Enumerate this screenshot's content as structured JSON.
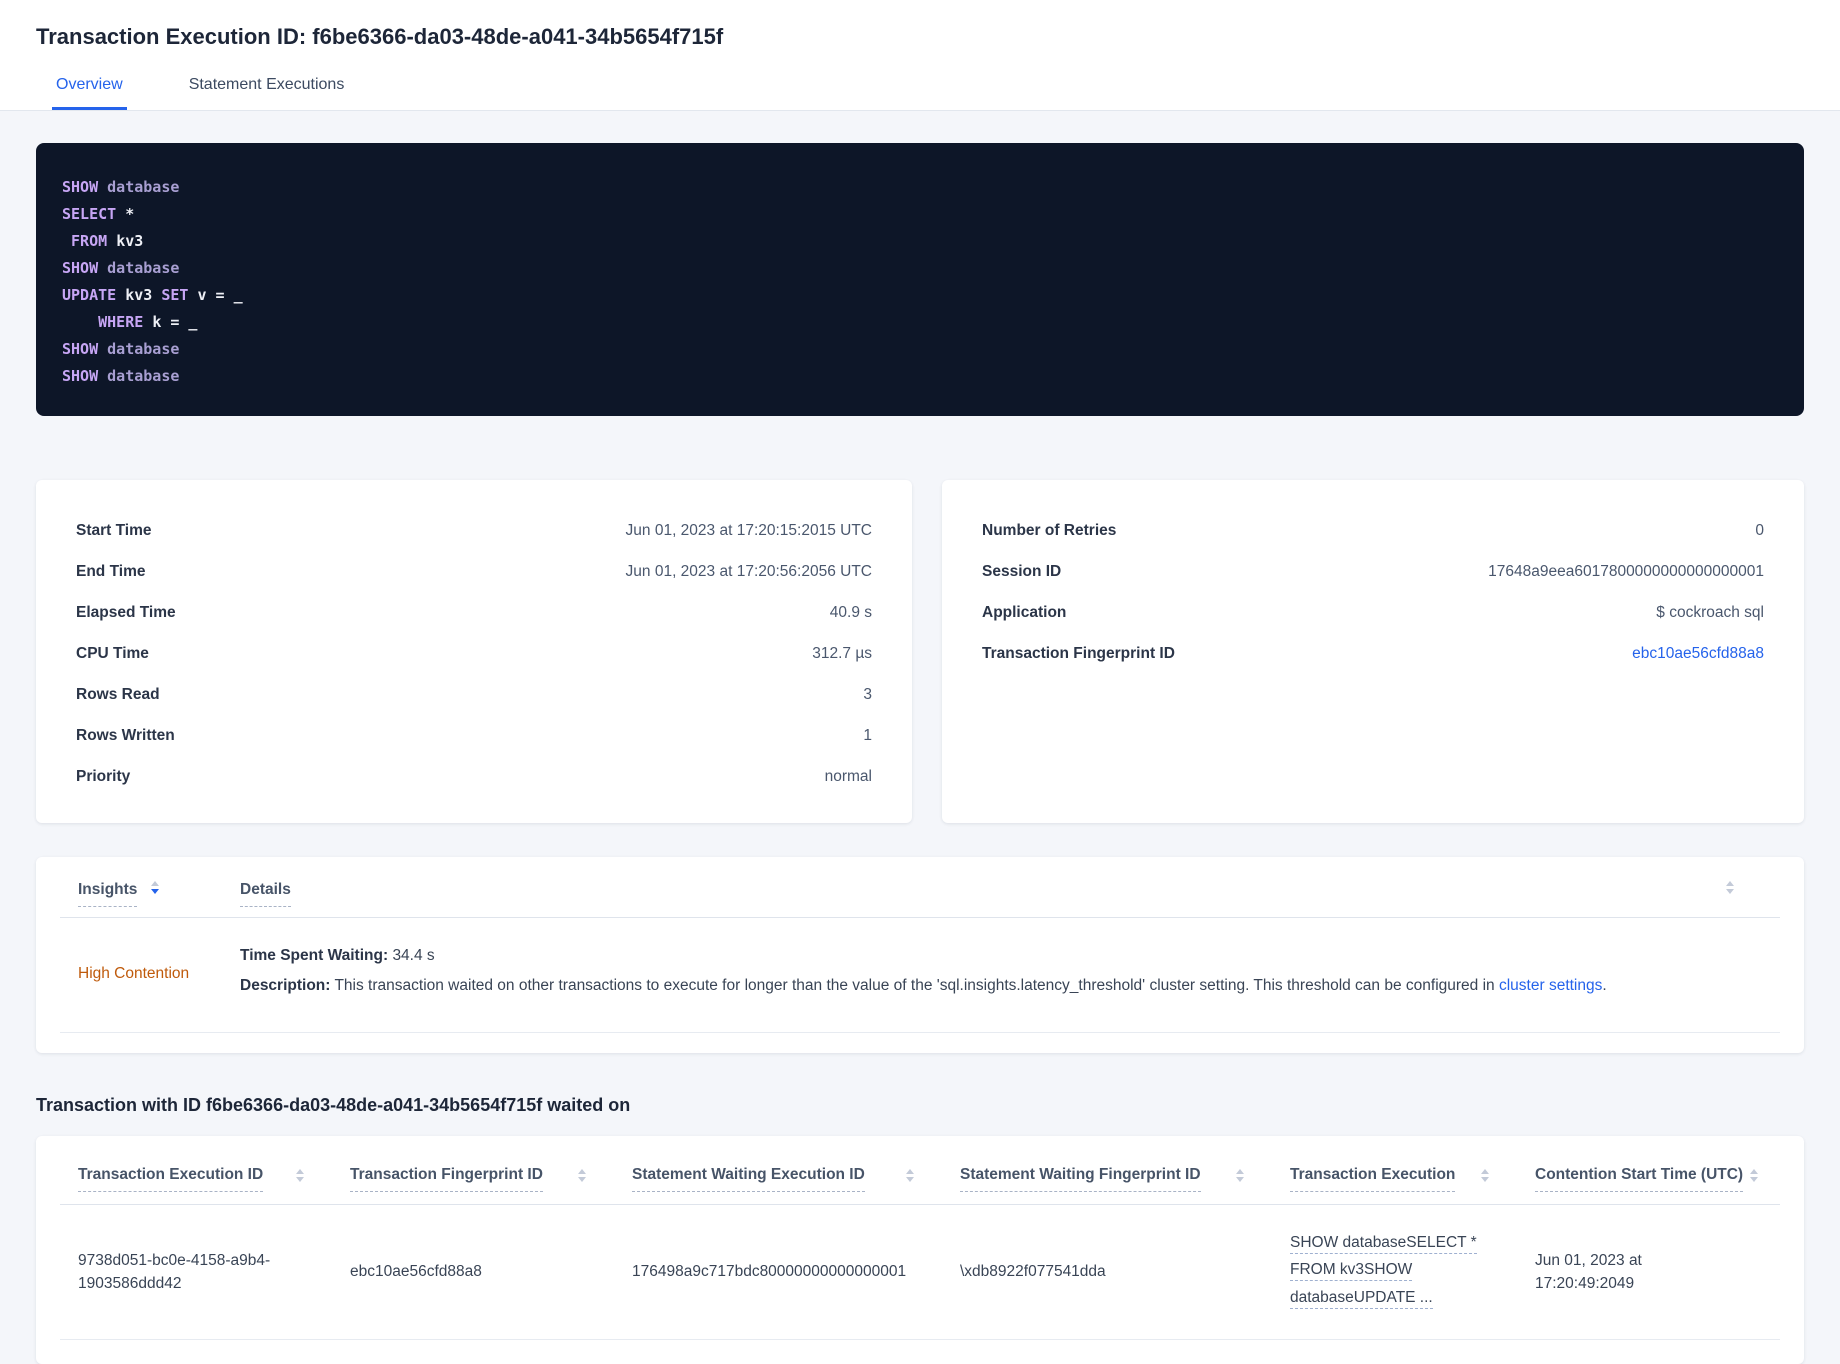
{
  "header": {
    "title": "Transaction Execution ID: f6be6366-da03-48de-a041-34b5654f715f",
    "tabs": [
      {
        "label": "Overview",
        "active": true
      },
      {
        "label": "Statement Executions",
        "active": false
      }
    ]
  },
  "sql": {
    "lines": [
      {
        "s": [
          {
            "t": "SHOW ",
            "k": "kw"
          },
          {
            "t": "database",
            "k": "db"
          }
        ]
      },
      {
        "s": [
          {
            "t": "SELECT ",
            "k": "kw"
          },
          {
            "t": "*",
            "k": "pl"
          }
        ]
      },
      {
        "s": [
          {
            "t": " ",
            "k": "pl"
          },
          {
            "t": "FROM ",
            "k": "kw"
          },
          {
            "t": "kv3",
            "k": "pl"
          }
        ]
      },
      {
        "s": [
          {
            "t": "SHOW ",
            "k": "kw"
          },
          {
            "t": "database",
            "k": "db"
          }
        ]
      },
      {
        "s": [
          {
            "t": "UPDATE ",
            "k": "kw"
          },
          {
            "t": "kv3 ",
            "k": "pl"
          },
          {
            "t": "SET ",
            "k": "kw"
          },
          {
            "t": "v = _",
            "k": "pl"
          }
        ]
      },
      {
        "s": [
          {
            "t": "    ",
            "k": "pl"
          },
          {
            "t": "WHERE ",
            "k": "kw"
          },
          {
            "t": "k = _",
            "k": "pl"
          }
        ]
      },
      {
        "s": [
          {
            "t": "SHOW ",
            "k": "kw"
          },
          {
            "t": "database",
            "k": "db"
          }
        ]
      },
      {
        "s": [
          {
            "t": "SHOW ",
            "k": "kw"
          },
          {
            "t": "database",
            "k": "db"
          }
        ]
      }
    ]
  },
  "summary_left": {
    "rows": [
      {
        "label": "Start Time",
        "value": "Jun 01, 2023 at 17:20:15:2015 UTC"
      },
      {
        "label": "End Time",
        "value": "Jun 01, 2023 at 17:20:56:2056 UTC"
      },
      {
        "label": "Elapsed Time",
        "value": "40.9 s"
      },
      {
        "label": "CPU Time",
        "value": "312.7 µs"
      },
      {
        "label": "Rows Read",
        "value": "3"
      },
      {
        "label": "Rows Written",
        "value": "1"
      },
      {
        "label": "Priority",
        "value": "normal"
      }
    ]
  },
  "summary_right": {
    "rows": [
      {
        "label": "Number of Retries",
        "value": "0"
      },
      {
        "label": "Session ID",
        "value": "17648a9eea6017800000000000000001"
      },
      {
        "label": "Application",
        "value": "$ cockroach sql"
      },
      {
        "label": "Transaction Fingerprint ID",
        "value": "ebc10ae56cfd88a8"
      }
    ]
  },
  "insights": {
    "col_insights": "Insights",
    "col_details": "Details",
    "row": {
      "insight": "High Contention",
      "waiting_label": "Time Spent Waiting:",
      "waiting_value": "34.4 s",
      "description_label": "Description:",
      "description_text": "This transaction waited on other transactions to execute for longer than the value of the 'sql.insights.latency_threshold' cluster setting. This threshold can be configured in",
      "description_link": "cluster settings",
      "description_end": "."
    }
  },
  "waited_on": {
    "heading": "Transaction with ID f6be6366-da03-48de-a041-34b5654f715f waited on",
    "columns": [
      "Transaction Execution ID",
      "Transaction Fingerprint ID",
      "Statement Waiting Execution ID",
      "Statement Waiting Fingerprint ID",
      "Transaction Execution",
      "Contention Start Time (UTC)"
    ],
    "row": {
      "txn_execution_id": "9738d051-bc0e-4158-a9b4-1903586ddd42",
      "txn_fingerprint_id": "ebc10ae56cfd88a8",
      "stmt_waiting_execution_id": "176498a9c717bdc80000000000000001",
      "stmt_waiting_fingerprint_id": "\\xdb8922f077541dda",
      "txn_execution_lines": [
        "SHOW databaseSELECT *",
        "FROM kv3SHOW",
        "databaseUPDATE ..."
      ],
      "contention_start_time": "Jun 01, 2023 at 17:20:49:2049"
    }
  },
  "colors": {
    "accent_blue": "#2563eb",
    "warning_orange": "#bf5a0b",
    "code_background": "#0d1628",
    "code_keyword": "#c7a6f5",
    "code_identifier": "#a89fd2"
  }
}
